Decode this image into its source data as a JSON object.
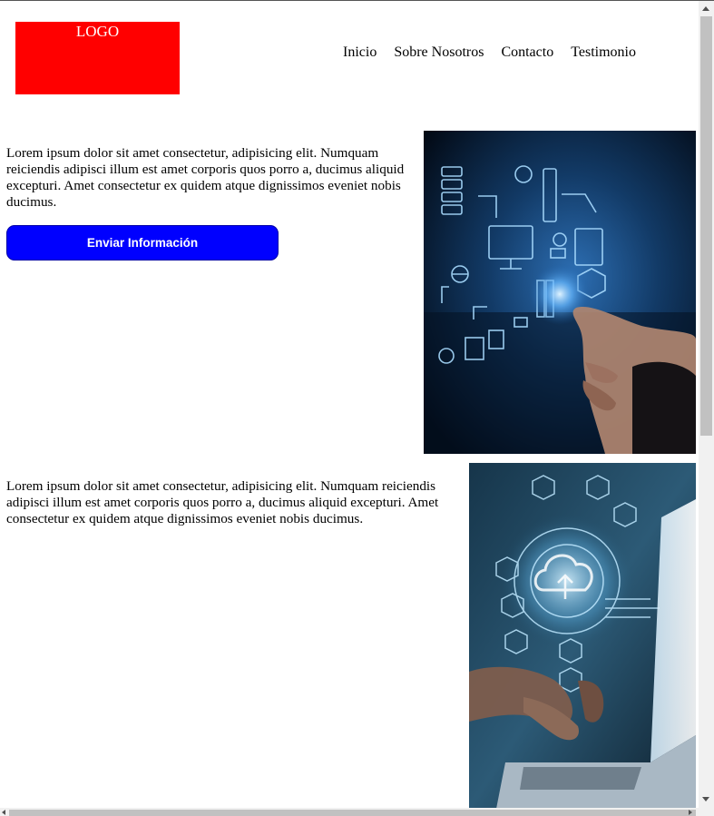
{
  "header": {
    "logo_text": "LOGO",
    "logo_color": "#ff0000",
    "nav": [
      {
        "label": "Inicio"
      },
      {
        "label": "Sobre Nosotros"
      },
      {
        "label": "Contacto"
      },
      {
        "label": "Testimonio"
      }
    ]
  },
  "section1": {
    "paragraph": "Lorem ipsum dolor sit amet consectetur, adipisicing elit. Numquam reiciendis adipisci illum est amet corporis quos porro a, ducimus aliquid excepturi. Amet consectetur ex quidem atque dignissimos eveniet nobis ducimus.",
    "button_label": "Enviar Información",
    "button_color": "#0000ff",
    "image_icon": "technology-network-image"
  },
  "section2": {
    "paragraph": "Lorem ipsum dolor sit amet consectetur, adipisicing elit. Numquam reiciendis adipisci illum est amet corporis quos porro a, ducimus aliquid excepturi. Amet consectetur ex quidem atque dignissimos eveniet nobis ducimus.",
    "image_icon": "cloud-computing-laptop-image"
  }
}
